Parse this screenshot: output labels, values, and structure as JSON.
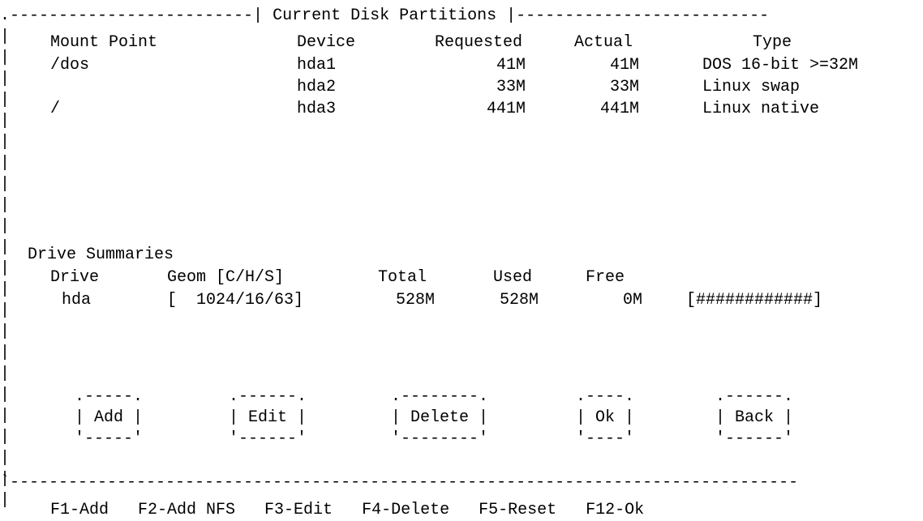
{
  "window": {
    "title": "Current Disk Partitions"
  },
  "partitions": {
    "headers": [
      "Mount Point",
      "Device",
      "Requested",
      "Actual",
      "Type"
    ],
    "rows": [
      [
        "/dos",
        "hda1",
        "41M",
        "41M",
        "DOS 16-bit >=32M"
      ],
      [
        "",
        "hda2",
        "33M",
        "33M",
        "Linux swap"
      ],
      [
        "/",
        "hda3",
        "441M",
        "441M",
        "Linux native"
      ]
    ]
  },
  "drive_summaries": {
    "title": "Drive Summaries",
    "headers": [
      "Drive",
      "Geom [C/H/S]",
      "Total",
      "Used",
      "Free"
    ],
    "rows": [
      [
        "hda",
        "[  1024/16/63]",
        "528M",
        "528M",
        "0M",
        "[############]"
      ]
    ]
  },
  "buttons": [
    "Add",
    "Edit",
    "Delete",
    "Ok",
    "Back"
  ],
  "function_keys": "F1-Add   F2-Add NFS   F3-Edit   F4-Delete   F5-Reset   F12-Ok"
}
